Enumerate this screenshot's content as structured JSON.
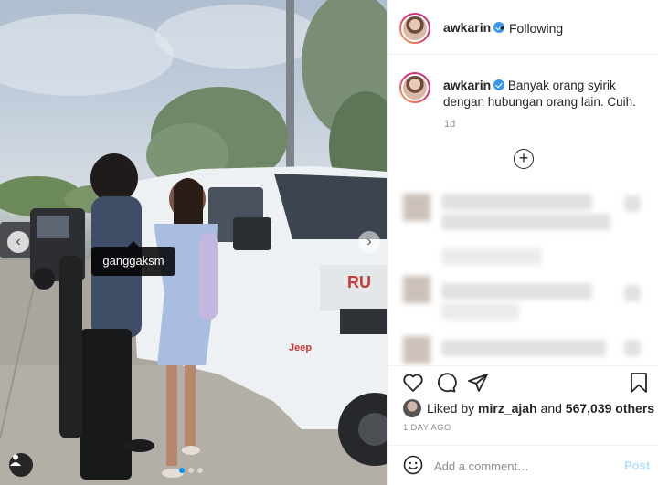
{
  "photo": {
    "tag_label": "ganggaksm",
    "carousel_dots": 3,
    "active_dot": 0,
    "car_badge": "Jeep",
    "car_grille_text": "RU"
  },
  "post": {
    "username": "awkarin",
    "verified": true,
    "separator": "•",
    "follow_status": "Following",
    "caption_username": "awkarin",
    "caption_text": "Banyak orang syirik dengan hubungan orang lain. Cuih.",
    "caption_time": "1d",
    "load_more_icon": "plus-circle-icon"
  },
  "engagement": {
    "liked_by_prefix": "Liked by",
    "liked_by_user": "mirz_ajah",
    "liked_by_and": "and",
    "like_count": "567,039 others",
    "date": "1 DAY AGO"
  },
  "comment_box": {
    "placeholder": "Add a comment…",
    "post_label": "Post"
  },
  "icons": [
    "heart-icon",
    "comment-icon",
    "share-icon",
    "bookmark-icon",
    "emoji-icon",
    "user-tag-icon",
    "chevron-left-icon",
    "chevron-right-icon"
  ],
  "colors": {
    "verified_blue": "#3897f0",
    "post_button_disabled": "#b2dffc",
    "secondary_text": "#8e8e8e",
    "border": "#efefef"
  }
}
